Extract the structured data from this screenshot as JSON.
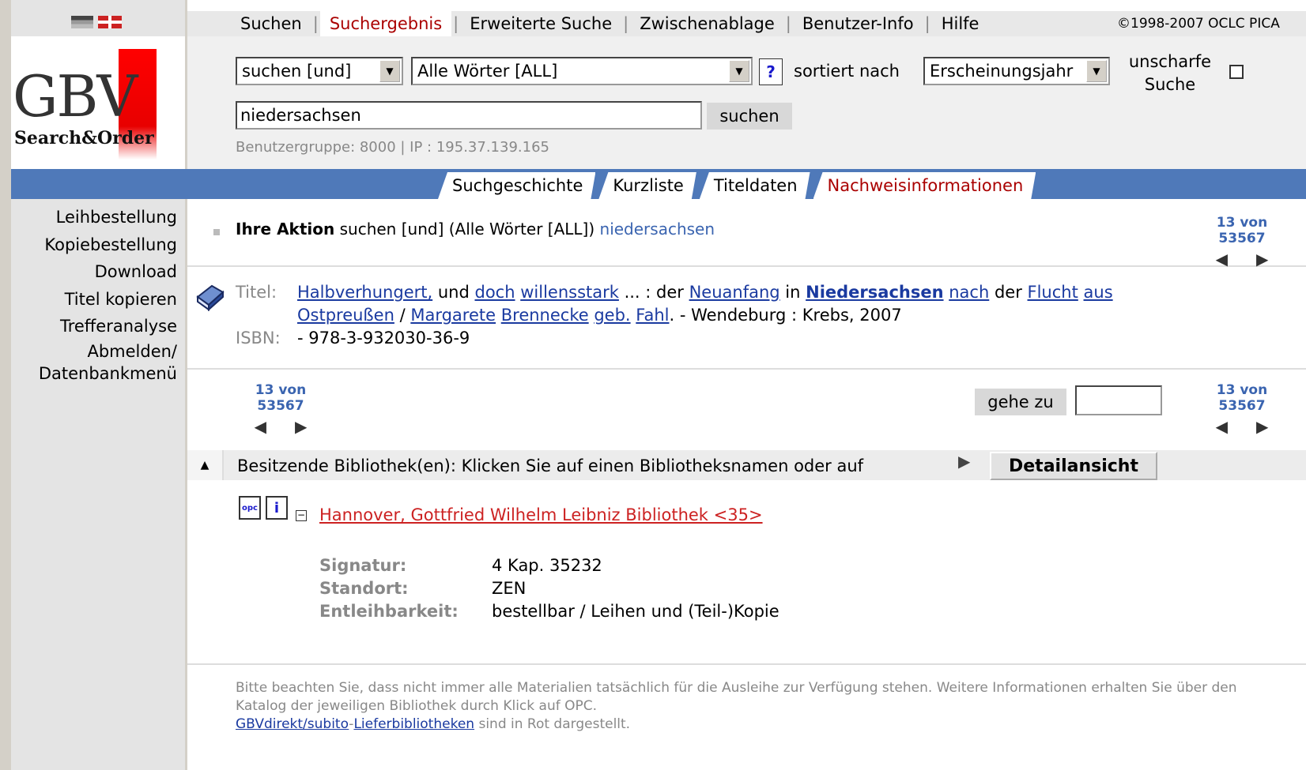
{
  "header": {
    "menu": [
      "Suchen",
      "Suchergebnis",
      "Erweiterte Suche",
      "Zwischenablage",
      "Benutzer-Info",
      "Hilfe"
    ],
    "active_menu": "Suchergebnis",
    "copyright": "©1998-2007 OCLC PICA"
  },
  "logo": {
    "big": "GBV",
    "small": "Search&Order"
  },
  "search": {
    "operator": "suchen [und]",
    "index": "Alle Wörter [ALL]",
    "help": "?",
    "sorted_label": "sortiert nach",
    "sort_value": "Erscheinungsjahr",
    "fuzzy_line1": "unscharfe",
    "fuzzy_line2": "Suche",
    "query": "niedersachsen",
    "button": "suchen",
    "usergroup": "Benutzergruppe: 8000 | IP : 195.37.139.165"
  },
  "tabs": [
    "Suchgeschichte",
    "Kurzliste",
    "Titeldaten",
    "Nachweisinformationen"
  ],
  "active_tab": "Nachweisinformationen",
  "sidebar": [
    "Leihbestellung",
    "Kopiebestellung",
    "Download",
    "Titel kopieren",
    "Trefferanalyse",
    "Abmelden/",
    "Datenbankmenü"
  ],
  "action": {
    "label": "Ihre Aktion",
    "text": "suchen [und] (Alle Wörter [ALL])",
    "term": "niedersachsen",
    "counter": "13 von 53567"
  },
  "record": {
    "title_label": "Titel:",
    "isbn_label": "ISBN:",
    "isbn": "- 978-3-932030-36-9",
    "title_line1": [
      {
        "t": "Halbverhungert,",
        "link": true
      },
      {
        "t": " und ",
        "link": false
      },
      {
        "t": "doch",
        "link": true
      },
      {
        "t": " ",
        "link": false
      },
      {
        "t": "willensstark",
        "link": true
      },
      {
        "t": " ... : der ",
        "link": false
      },
      {
        "t": "Neuanfang",
        "link": true
      },
      {
        "t": " in ",
        "link": false
      },
      {
        "t": "Niedersachsen",
        "link": true,
        "bold": true
      },
      {
        "t": " ",
        "link": false
      },
      {
        "t": "nach",
        "link": true
      },
      {
        "t": " der ",
        "link": false
      },
      {
        "t": "Flucht",
        "link": true
      },
      {
        "t": " ",
        "link": false
      },
      {
        "t": "aus",
        "link": true
      }
    ],
    "title_line2": [
      {
        "t": "Ostpreußen",
        "link": true
      },
      {
        "t": " / ",
        "link": false
      },
      {
        "t": "Margarete",
        "link": true
      },
      {
        "t": " ",
        "link": false
      },
      {
        "t": "Brennecke",
        "link": true
      },
      {
        "t": " ",
        "link": false
      },
      {
        "t": "geb.",
        "link": true
      },
      {
        "t": " ",
        "link": false
      },
      {
        "t": "Fahl",
        "link": true
      },
      {
        "t": ". - Wendeburg : Krebs, 2007",
        "link": false
      }
    ]
  },
  "nav": {
    "counter": "13 von 53567",
    "goto": "gehe zu"
  },
  "holdings": {
    "header": "Besitzende Bibliothek(en): Klicken Sie auf einen Bibliotheksnamen oder auf",
    "detail_button": "Detailansicht",
    "opc_label": "opc",
    "info_label": "i",
    "library": "Hannover, Gottfried Wilhelm Leibniz Bibliothek <35>",
    "fields": [
      {
        "k": "Signatur:",
        "v": "4 Kap. 35232"
      },
      {
        "k": "Standort:",
        "v": "ZEN"
      },
      {
        "k": "Entleihbarkeit:",
        "v": "bestellbar / Leihen und (Teil-)Kopie"
      }
    ]
  },
  "note": {
    "text": "Bitte beachten Sie, dass nicht immer alle Materialien tatsächlich für die Ausleihe zur Verfügung stehen. Weitere Informationen erhalten Sie über den Katalog der jeweiligen Bibliothek durch Klick auf OPC.",
    "link1": "GBVdirekt/subito",
    "dash": "-",
    "link2": "Lieferbibliotheken",
    "suffix": " sind in Rot dargestellt."
  },
  "colors": {
    "band": "#4f79b9",
    "active": "#aa0000",
    "link": "#1a3aa0",
    "library": "#cc2222"
  }
}
